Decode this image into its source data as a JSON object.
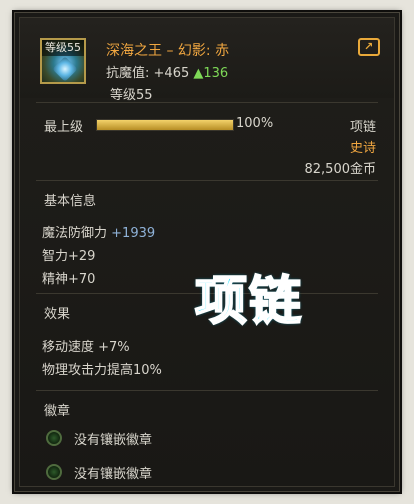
{
  "item": {
    "level_tag": "等级55",
    "title": "深海之王 – 幻影: 赤",
    "resist_label": "抗魔值:",
    "resist_value": "+465",
    "resist_bonus": "▲136",
    "level_text": "等级55",
    "share_icon": "share-icon"
  },
  "upgrade": {
    "label": "最上级",
    "percent_text": "100%",
    "fill_fraction": 1.0
  },
  "meta": {
    "type": "项链",
    "rarity": "史诗",
    "price": "82,500金币",
    "rarity_color": "#f0a640"
  },
  "basic": {
    "title": "基本信息",
    "magic_def_label": "魔法防御力",
    "magic_def_value": "+1939",
    "intelligence": "智力+29",
    "spirit": "精神+70"
  },
  "effects": {
    "title": "效果",
    "items": [
      "移动速度 +7%",
      "物理攻击力提高10%"
    ]
  },
  "emblems": {
    "title": "徽章",
    "slots": [
      "没有镶嵌徽章",
      "没有镶嵌徽章"
    ]
  },
  "overlay": {
    "text": "项链"
  }
}
